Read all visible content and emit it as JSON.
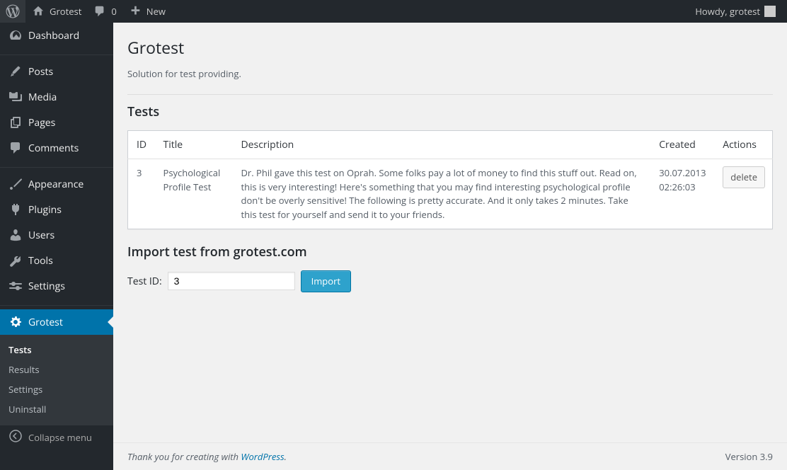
{
  "adminbar": {
    "site_name": "Grotest",
    "comments_count": "0",
    "new_label": "New",
    "howdy": "Howdy, grotest"
  },
  "sidebar": {
    "items": [
      {
        "label": "Dashboard"
      },
      {
        "label": "Posts"
      },
      {
        "label": "Media"
      },
      {
        "label": "Pages"
      },
      {
        "label": "Comments"
      },
      {
        "label": "Appearance"
      },
      {
        "label": "Plugins"
      },
      {
        "label": "Users"
      },
      {
        "label": "Tools"
      },
      {
        "label": "Settings"
      },
      {
        "label": "Grotest"
      }
    ],
    "submenu": [
      {
        "label": "Tests"
      },
      {
        "label": "Results"
      },
      {
        "label": "Settings"
      },
      {
        "label": "Uninstall"
      }
    ],
    "collapse": "Collapse menu"
  },
  "page": {
    "title": "Grotest",
    "subtitle": "Solution for test providing.",
    "tests_heading": "Tests",
    "import_heading": "Import test from grotest.com",
    "test_id_label": "Test ID:",
    "test_id_value": "3",
    "import_button": "Import"
  },
  "table": {
    "headers": {
      "id": "ID",
      "title": "Title",
      "description": "Description",
      "created": "Created",
      "actions": "Actions"
    },
    "rows": [
      {
        "id": "3",
        "title": "Psychological Profile Test",
        "description": "Dr. Phil gave this test on Oprah. Some folks pay a lot of money to find this stuff out. Read on, this is very interesting! Here's something that you may find interesting psychological profile don't be overly sensitive! The following is pretty accurate. And it only takes 2 minutes. Take this test for yourself and send it to your friends.",
        "created": "30.07.2013 02:26:03",
        "delete": "delete"
      }
    ]
  },
  "footer": {
    "thanks_prefix": "Thank you for creating with ",
    "wp_link": "WordPress",
    "thanks_suffix": ".",
    "version": "Version 3.9"
  }
}
